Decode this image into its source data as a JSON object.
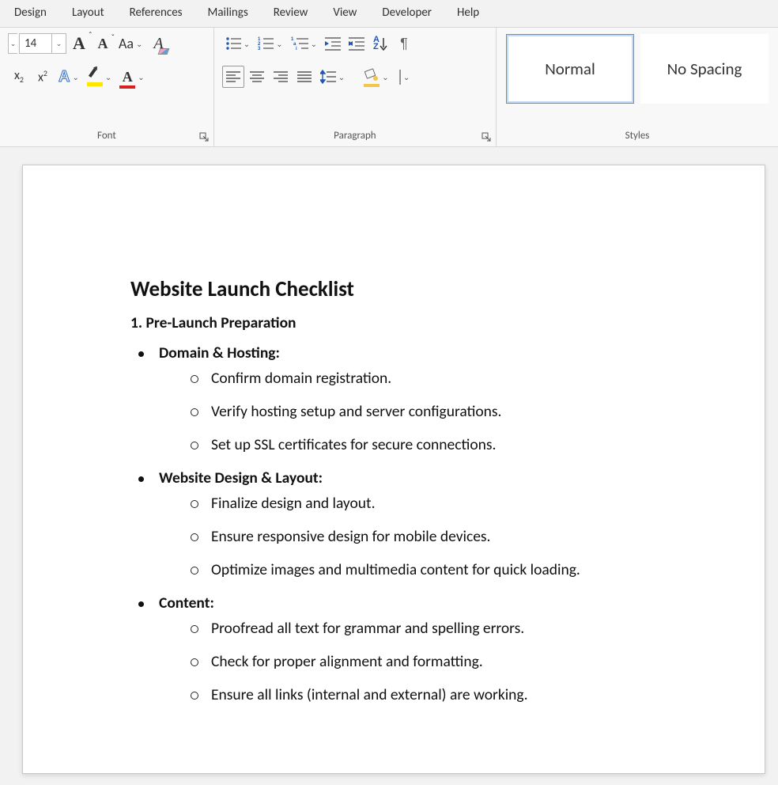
{
  "tabs": {
    "design": "Design",
    "layout": "Layout",
    "references": "References",
    "mailings": "Mailings",
    "review": "Review",
    "view": "View",
    "developer": "Developer",
    "help": "Help"
  },
  "font": {
    "size": "14",
    "group_label": "Font"
  },
  "paragraph": {
    "group_label": "Paragraph"
  },
  "styles": {
    "group_label": "Styles",
    "normal": "Normal",
    "no_spacing": "No Spacing"
  },
  "document": {
    "title": "Website Launch Checklist",
    "section1_head": "1. Pre-Launch Preparation",
    "b1": "Domain & Hosting:",
    "b1_items": {
      "i1": "Confirm domain registration.",
      "i2": "Verify hosting setup and server configurations.",
      "i3": "Set up SSL certificates for secure connections."
    },
    "b2": "Website Design & Layout:",
    "b2_items": {
      "i1": "Finalize design and layout.",
      "i2": "Ensure responsive design for mobile devices.",
      "i3": "Optimize images and multimedia content for quick loading."
    },
    "b3": "Content:",
    "b3_items": {
      "i1": "Proofread all text for grammar and spelling errors.",
      "i2": "Check for proper alignment and formatting.",
      "i3": "Ensure all links (internal and external) are working."
    }
  }
}
